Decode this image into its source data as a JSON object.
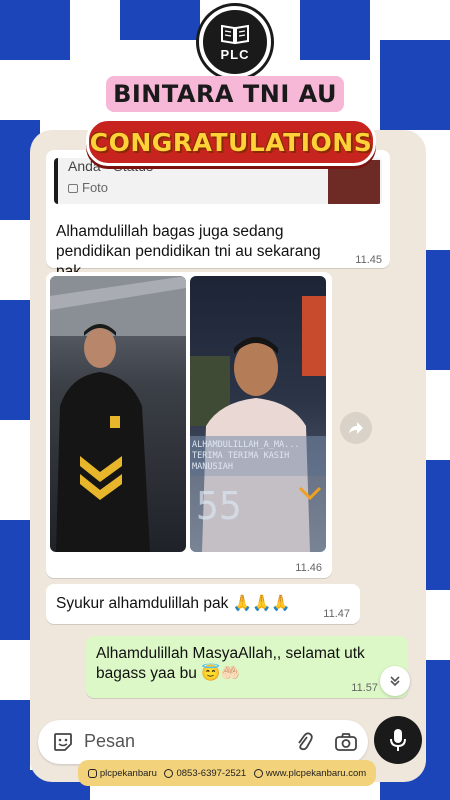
{
  "header": {
    "logo_text": "PLC",
    "title": "BINTARA TNI AU",
    "banner": "CONGRATULATIONS"
  },
  "chat": {
    "messages": [
      {
        "direction": "incoming",
        "quote": {
          "author": "Anda • Status",
          "type": "Foto"
        },
        "text": "Alhamdulillah bagas juga sedang pendidikan pendidikan tni au sekarang pak",
        "time": "11.45"
      },
      {
        "direction": "incoming",
        "type": "photos",
        "overlay_text": "ALHAMDULILLAH_A_MA... TERIMA TERIMA KASIH MANUSIAH",
        "overlay_number": "55",
        "time": "11.46"
      },
      {
        "direction": "incoming",
        "text": "Syukur alhamdulillah pak",
        "emoji": "🙏🙏🙏",
        "time": "11.47"
      },
      {
        "direction": "outgoing",
        "text": "Alhamdulillah MasyaAllah,, selamat utk bagass yaa bu",
        "emoji": "😇🤲🏻",
        "time": "11.57"
      }
    ],
    "input": {
      "placeholder": "Pesan"
    }
  },
  "footer": {
    "instagram": "plcpekanbaru",
    "phone": "0853-6397-2521",
    "website": "www.plcpekanbaru.com"
  },
  "colors": {
    "brand_blue": "#1b45b8",
    "chat_bg": "#efe6dc",
    "outgoing_bubble": "#dcf8c6",
    "banner_red": "#c8241f",
    "banner_gold": "#ffd23a",
    "title_pink": "#f7b8d8",
    "footer_yellow": "#f3d27c"
  },
  "icons": [
    "book-icon",
    "forward-icon",
    "chevron-down-icon",
    "sticker-icon",
    "attach-icon",
    "camera-icon",
    "mic-icon",
    "instagram-icon",
    "phone-icon",
    "globe-icon",
    "photo-icon"
  ]
}
